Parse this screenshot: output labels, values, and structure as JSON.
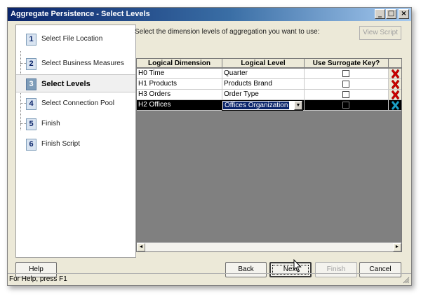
{
  "window": {
    "title": "Aggregate Persistence - Select Levels",
    "min_glyph": "_",
    "max_glyph": "□",
    "close_glyph": "×"
  },
  "nav": {
    "items": [
      {
        "num": "1",
        "label": "Select File Location"
      },
      {
        "num": "2",
        "label": "Select Business Measures"
      },
      {
        "num": "3",
        "label": "Select Levels"
      },
      {
        "num": "4",
        "label": "Select Connection Pool"
      },
      {
        "num": "5",
        "label": "Finish"
      },
      {
        "num": "6",
        "label": "Finish Script"
      }
    ],
    "active_index": 2
  },
  "main": {
    "instruction": "Select the dimension levels of aggregation you want to use:",
    "view_script_label": "View Script"
  },
  "grid": {
    "columns": [
      "Logical Dimension",
      "Logical Level",
      "Use Surrogate Key?"
    ],
    "rows": [
      {
        "dimension": "H0 Time",
        "level": "Quarter",
        "surrogate": false
      },
      {
        "dimension": "H1 Products",
        "level": "Products Brand",
        "surrogate": false
      },
      {
        "dimension": "H3 Orders",
        "level": "Order Type",
        "surrogate": false
      },
      {
        "dimension": "H2 Offices",
        "level": "Offices Organization",
        "surrogate": false
      }
    ],
    "selected_row": 3,
    "scroll_left": "◄",
    "scroll_right": "►",
    "dropdown_arrow": "▼"
  },
  "buttons": {
    "help": "Help",
    "back": "Back",
    "next": "Next",
    "finish": "Finish",
    "cancel": "Cancel"
  },
  "status": {
    "text": "For Help, press F1"
  },
  "colors": {
    "delete_icon": "#cc0000",
    "delete_icon_selected": "#1ba1c7",
    "nav_active_badge": "#7f9db9"
  }
}
